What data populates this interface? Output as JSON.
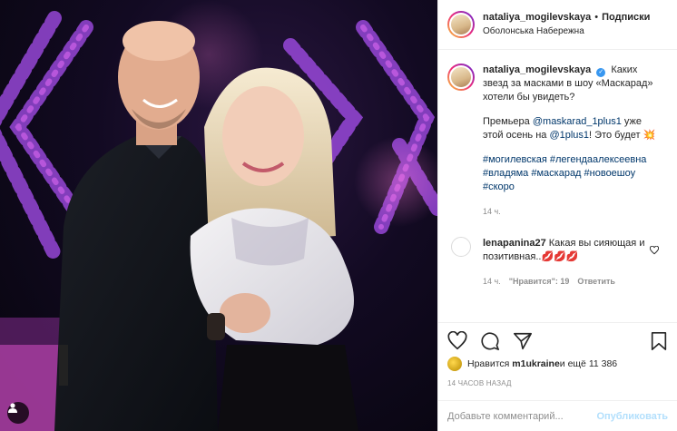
{
  "post": {
    "author": "nataliya_mogilevskaya",
    "follow_label": "Подписки",
    "location": "Оболонська Набережна"
  },
  "caption": {
    "line1": "Каких звезд за масками в шоу «Маскарад» хотели бы увидеть?",
    "p2_text1": "Премьера ",
    "p2_link1": "@maskarad_1plus1",
    "p2_text2": " уже этой осень на ",
    "p2_link2": "@1plus1",
    "p2_text3": "! Это будет ",
    "p2_emoji": "💥",
    "hashtags": "#могилевская #легендаалексеевна #владяма #маскарад #новоешоу #скоро",
    "time": "14 ч."
  },
  "comment": {
    "author": "lenapanina27",
    "text": "Какая вы сияющая и позитивная..",
    "emoji": "💋💋💋",
    "time": "14 ч.",
    "likes": "\"Нравится\": 19",
    "reply": "Ответить"
  },
  "likes": {
    "prefix": "Нравится ",
    "user": "m1ukraine",
    "suffix": " и ещё 11 386"
  },
  "timestamp": "14 ЧАСОВ НАЗАД",
  "add_comment": {
    "placeholder": "Добавьте комментарий...",
    "publish": "Опубликовать"
  }
}
